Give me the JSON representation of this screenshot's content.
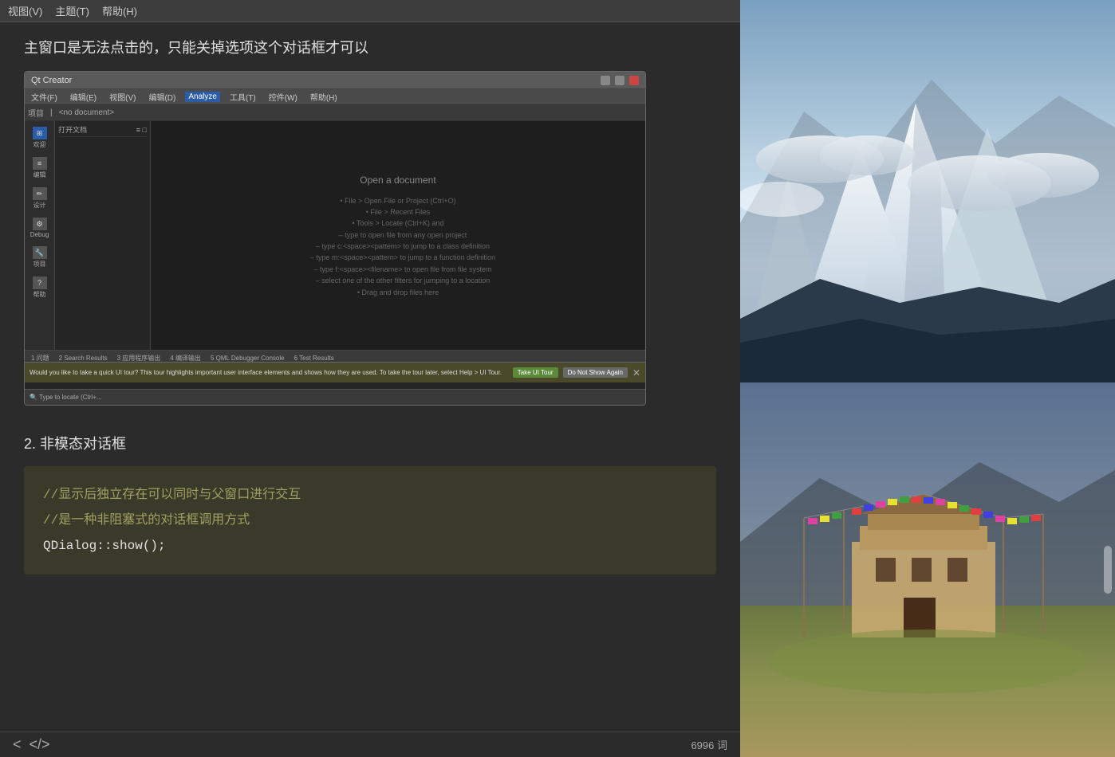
{
  "menubar": {
    "items": [
      "视图(V)",
      "主题(T)",
      "帮助(H)"
    ]
  },
  "section1": {
    "heading": "主窗口是无法点击的，只能关掉选项这个对话框才可以"
  },
  "qt_creator": {
    "title": "Qt Creator",
    "menu_items": [
      "文件(F)",
      "编辑(E)",
      "视图(V)",
      "编辑(D)",
      "Analyze",
      "工具(T)",
      "控件(W)",
      "帮助(H)"
    ],
    "active_menu": "Analyze",
    "toolbar": {
      "left_label": "项目",
      "right_label": "<no document>"
    },
    "sidebar_items": [
      {
        "icon": "⊞",
        "label": "欢迎"
      },
      {
        "icon": "≡",
        "label": "编辑"
      },
      {
        "icon": "✏",
        "label": "设计"
      },
      {
        "icon": "⚙",
        "label": "Debug"
      },
      {
        "icon": "🔧",
        "label": "项目"
      },
      {
        "icon": "?",
        "label": "帮助"
      }
    ],
    "open_doc_title": "Open a document",
    "open_doc_items": [
      "• File > Open File or Project (Ctrl+O)",
      "• File > Recent Files",
      "• Tools > Locate (Ctrl+K) and",
      "   - type to open file from any open project",
      "   - type c:<space><pattern> to jump to a class definition",
      "   - type m:<space><pattern> to jump to a function definition",
      "   - type f:<space><filename> to open file from file system",
      "   - select one of the other filters for jumping to a location",
      "• Drag and drop files here"
    ],
    "bottom_panel_label": "打开文档",
    "bottom_tabs": [
      "1 问题",
      "2 Search Results",
      "3 应用程序输出",
      "4 编译输出",
      "5 QML Debugger Console",
      "6 Test Results"
    ],
    "notification_text": "Would you like to take a quick UI tour? This tour highlights important user interface elements and shows how they are used. To take the tour later, select Help > UI Tour.",
    "notification_btn1": "Take UI Tour",
    "notification_btn2": "Do Not Show Again",
    "status_text": "🔍 Type to locate (Ctrl+..."
  },
  "section2": {
    "heading": "2. 非模态对话框",
    "code_lines": [
      {
        "type": "comment",
        "text": "//显示后独立存在可以同时与父窗口进行交互"
      },
      {
        "type": "comment",
        "text": "//是一种非阻塞式的对话框调用方式"
      },
      {
        "type": "code",
        "text": "QDialog::show();"
      }
    ]
  },
  "bottom_bar": {
    "nav_left": "<",
    "nav_right": "</>",
    "word_count": "6996 词"
  },
  "right_panel": {
    "top_alt": "Mountain landscape with snow and clouds",
    "bottom_alt": "Tibetan monastery with prayer flags"
  }
}
